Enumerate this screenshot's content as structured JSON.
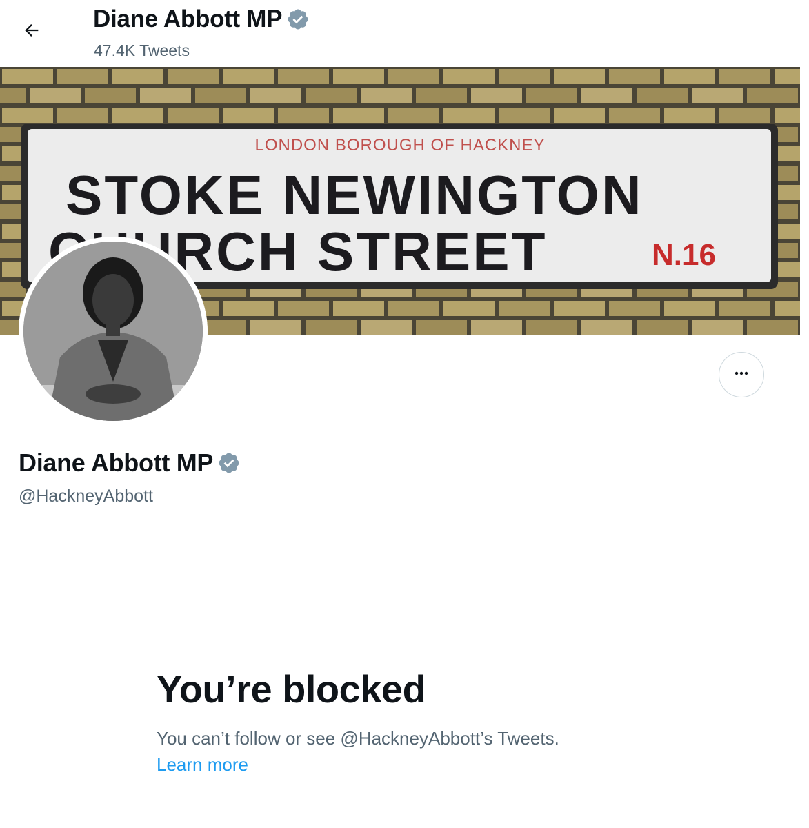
{
  "header": {
    "display_name": "Diane Abbott MP",
    "tweet_count": "47.4K Tweets",
    "back_icon": "arrow-left-icon",
    "verified_icon": "verified-badge-icon"
  },
  "banner": {
    "sign_top": "LONDON  BOROUGH  OF  HACKNEY",
    "sign_line1": "STOKE NEWINGTON",
    "sign_line2": "CHURCH STREET",
    "sign_code": "N.16"
  },
  "profile": {
    "display_name": "Diane Abbott MP",
    "handle": "@HackneyAbbott",
    "more_icon": "more-horizontal-icon"
  },
  "blocked": {
    "title": "You’re blocked",
    "description": "You can’t follow or see @HackneyAbbott’s Tweets.",
    "learn_more": "Learn more"
  },
  "colors": {
    "text_primary": "#0f1419",
    "text_secondary": "#536471",
    "link": "#1d9bf0",
    "verified_grey": "#829aab",
    "border": "#cfd9de"
  }
}
